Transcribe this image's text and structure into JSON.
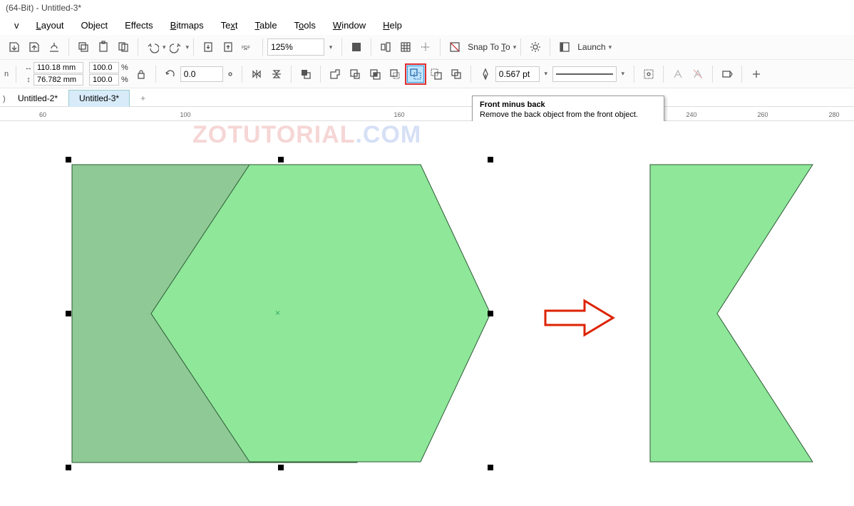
{
  "title": "(64-Bit) - Untitled-3*",
  "menu": {
    "m1": "Layout",
    "m2": "Object",
    "m3": "Effects",
    "m4": "Bitmaps",
    "m5": "Text",
    "m6": "Table",
    "m7": "Tools",
    "m8": "Window",
    "m9": "Help"
  },
  "toolbar1": {
    "zoom": "125%",
    "snap": "Snap To",
    "launch": "Launch"
  },
  "props": {
    "width": "110.18 mm",
    "height": "76.782 mm",
    "scaleX": "100.0",
    "scaleY": "100.0",
    "pctX": "%",
    "pctY": "%",
    "rotation": "0.0",
    "outline": "0.567 pt"
  },
  "tooltip": {
    "title": "Front minus back",
    "body": "Remove the back object from the front object."
  },
  "tabs": {
    "t1": "Untitled-2*",
    "t2": "Untitled-3*"
  },
  "ruler": {
    "r60": "60",
    "r100": "100",
    "r160": "160",
    "r240": "240",
    "r260": "260",
    "r280": "280"
  },
  "watermark": {
    "a": "ZOTUTORIAL",
    "b": ".COM"
  }
}
